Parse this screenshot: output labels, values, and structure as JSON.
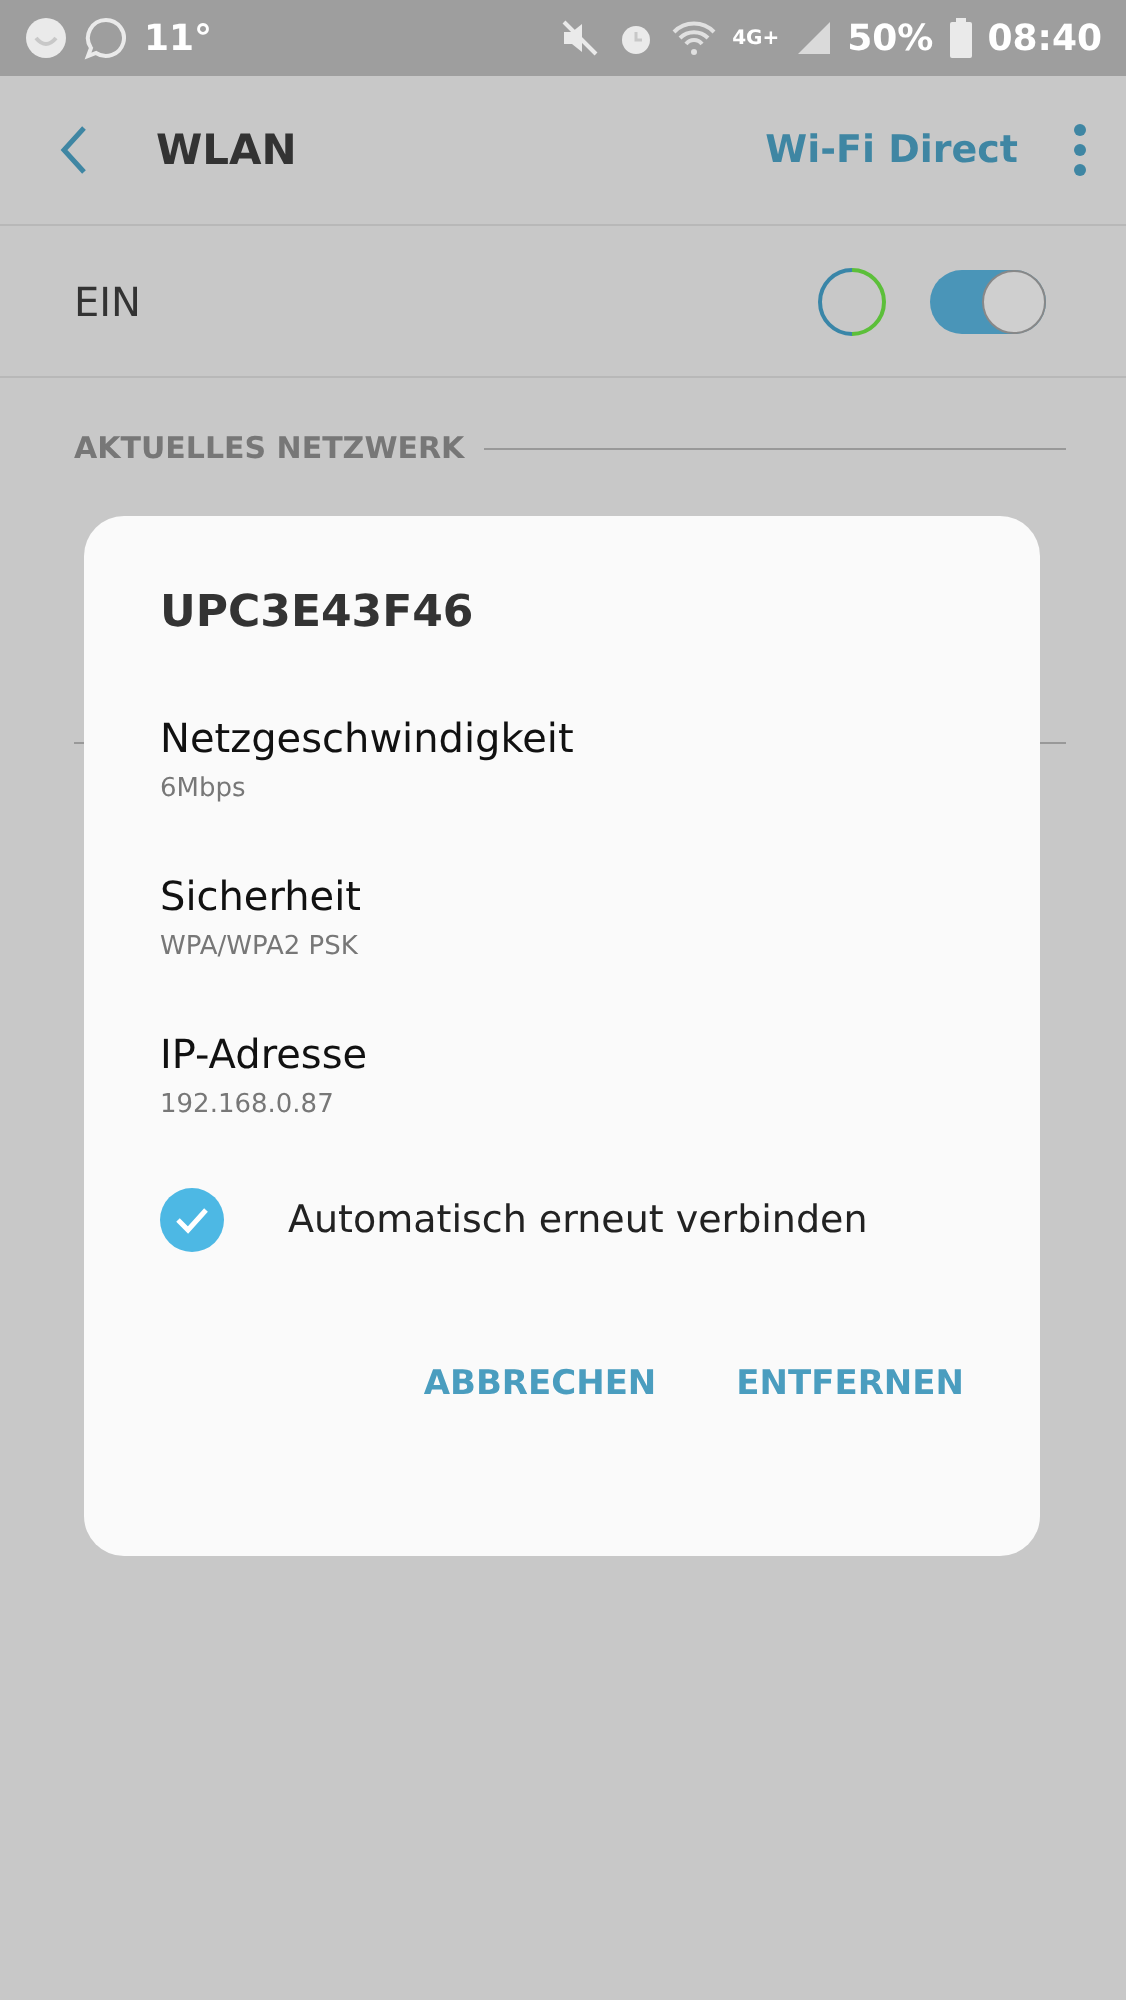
{
  "status_bar": {
    "temperature": "11°",
    "network": "4G+",
    "battery": "50%",
    "time": "08:40"
  },
  "header": {
    "title": "WLAN",
    "action": "Wi-Fi Direct"
  },
  "wlan_row": {
    "label": "EIN",
    "on": true
  },
  "sections": [
    {
      "title": "AKTUELLES NETZWERK"
    }
  ],
  "dialog": {
    "title": "UPC3E43F46",
    "details": [
      {
        "label": "Netzgeschwindigkeit",
        "value": "6Mbps"
      },
      {
        "label": "Sicherheit",
        "value": "WPA/WPA2 PSK"
      },
      {
        "label": "IP-Adresse",
        "value": "192.168.0.87"
      }
    ],
    "auto_reconnect": {
      "label": "Automatisch erneut verbinden",
      "checked": true
    },
    "buttons": [
      "ABBRECHEN",
      "ENTFERNEN"
    ]
  }
}
